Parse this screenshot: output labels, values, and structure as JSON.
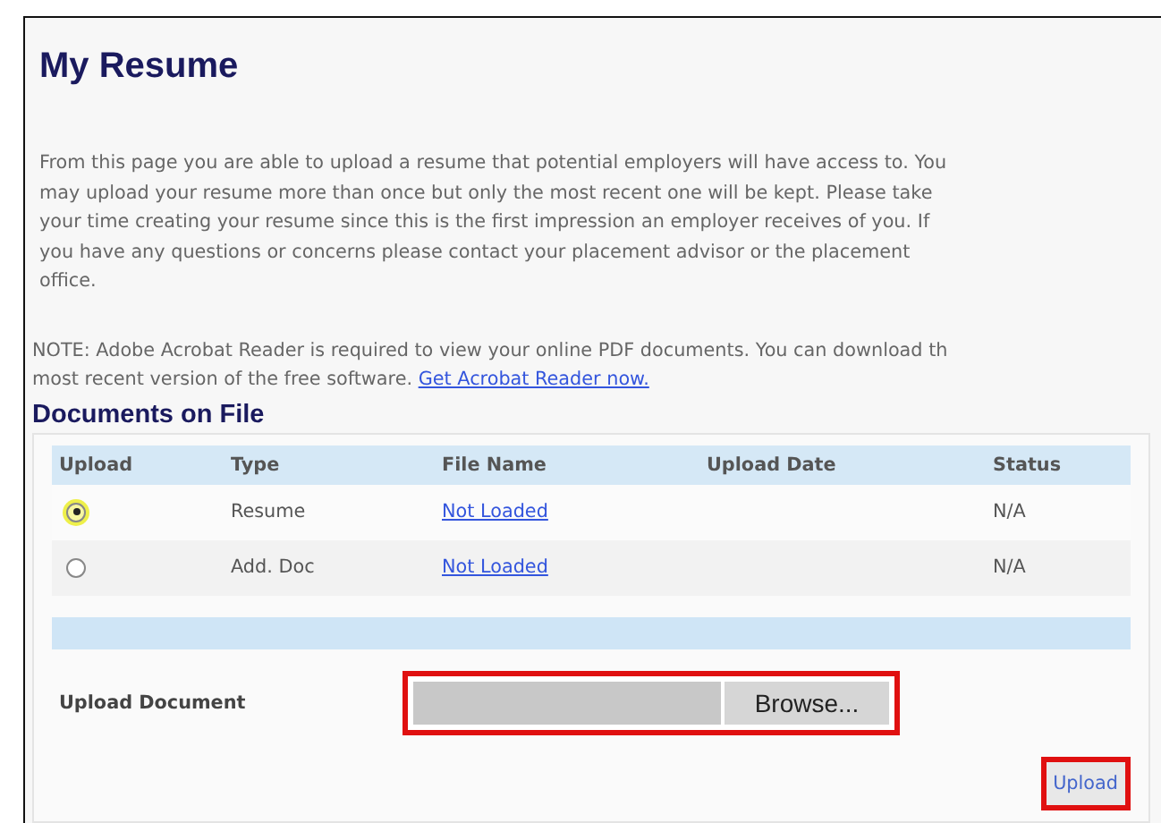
{
  "title": "My Resume",
  "intro": "From this page you are able to upload a resume that potential employers will have access to. You\nmay upload your resume more than once but only the most recent one will be kept. Please take\nyour time creating your resume since this is the first impression an employer receives of you. If\nyou have any questions or concerns please contact your placement advisor or the placement\noffice.",
  "note": "NOTE: Adobe Acrobat Reader is required to view your online PDF documents. You can download th\nmost recent version of the free software.",
  "note_link": "Get Acrobat Reader now.",
  "section_title": "Documents on File",
  "table": {
    "columns": [
      "Upload",
      "Type",
      "File Name",
      "Upload Date",
      "Status"
    ],
    "rows": [
      {
        "selected": true,
        "type": "Resume",
        "file_name": "Not Loaded",
        "status": "N/A"
      },
      {
        "selected": false,
        "type": "Add. Doc",
        "file_name": "Not Loaded",
        "status": "N/A"
      }
    ]
  },
  "upload_label": "Upload Document",
  "browse_button": "Browse...",
  "upload_button": "Upload"
}
